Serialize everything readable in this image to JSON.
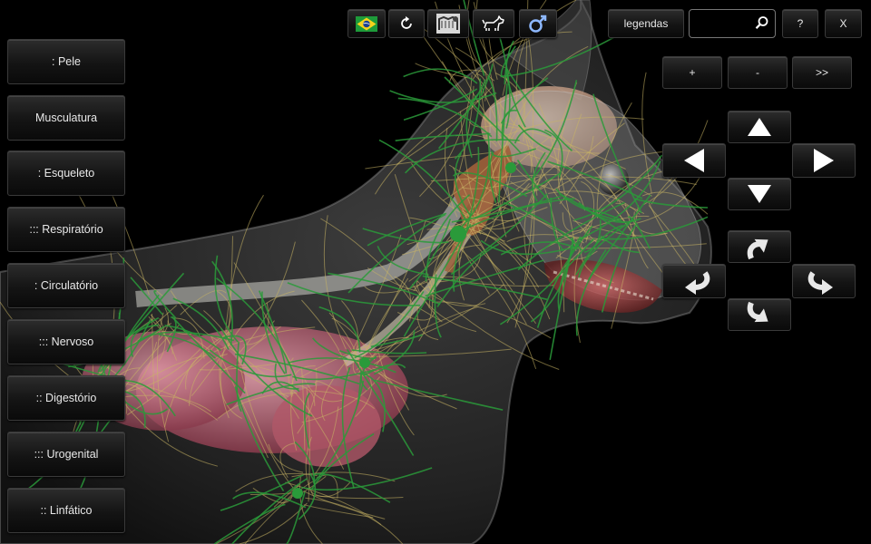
{
  "sidebar": {
    "items": [
      {
        "label": ": Pele"
      },
      {
        "label": "Musculatura"
      },
      {
        "label": ": Esqueleto"
      },
      {
        "label": "::: Respiratório"
      },
      {
        "label": ": Circulatório"
      },
      {
        "label": "::: Nervoso"
      },
      {
        "label": ":: Digestório"
      },
      {
        "label": "::: Urogenital"
      },
      {
        "label": ":: Linfático"
      }
    ]
  },
  "toolbar": {
    "language_icon": "brazil-flag-icon",
    "reset_icon": "rotate-icon",
    "skeleton_icon": "skeleton-thumbnail-icon",
    "animal_icon": "dog-icon",
    "sex_icon": "male-symbol-icon"
  },
  "topright": {
    "legend_label": "legendas",
    "search": {
      "value": "",
      "placeholder": ""
    },
    "help_label": "?",
    "close_label": "X"
  },
  "zoom": {
    "plus_label": "+",
    "minus_label": "-",
    "next_label": ">>"
  },
  "colors": {
    "nerve_green": "#2a9a3a",
    "nerve_yellow": "#c8b464",
    "lung_pink": "#c86a7a",
    "gland_brown": "#a0603a",
    "skin_gray": "#5a5a5a"
  }
}
